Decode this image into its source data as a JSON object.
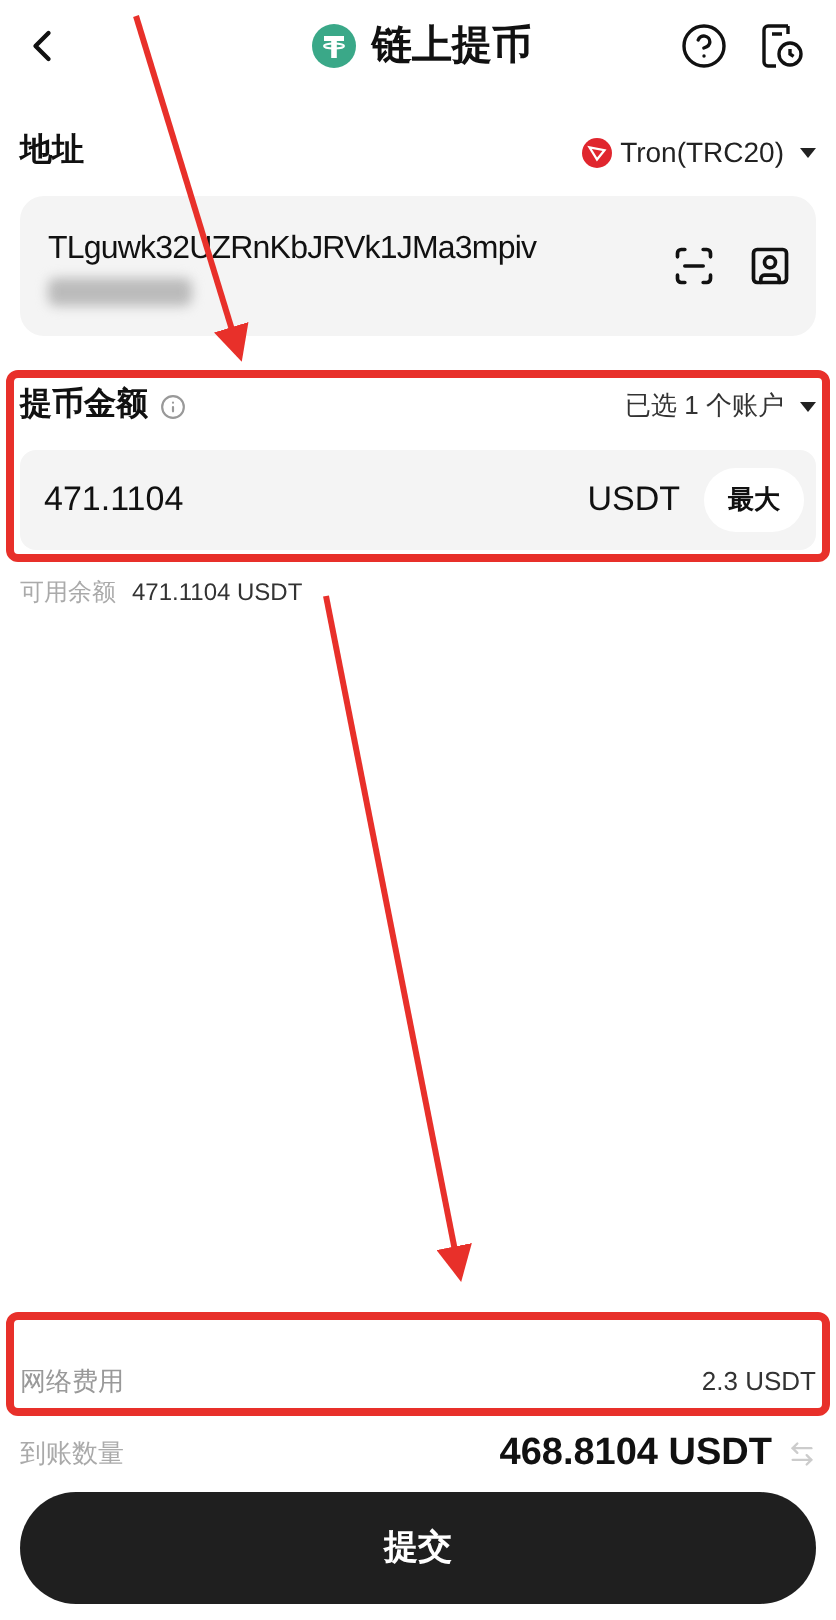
{
  "header": {
    "title": "链上提币"
  },
  "address": {
    "label": "地址",
    "network": "Tron(TRC20)",
    "value": "TLguwk32UZRnKbJRVk1JMa3mpiv",
    "redacted": true
  },
  "amount": {
    "label": "提币金额",
    "accounts": "已选 1 个账户",
    "value": "471.1104",
    "unit": "USDT",
    "max_button": "最大"
  },
  "available": {
    "label": "可用余额",
    "value": "471.1104 USDT"
  },
  "fee": {
    "label": "网络费用",
    "value": "2.3 USDT"
  },
  "received": {
    "label": "到账数量",
    "value": "468.8104 USDT"
  },
  "submit": "提交",
  "annotations": [
    {
      "kind": "arrow"
    },
    {
      "kind": "box"
    },
    {
      "kind": "arrow"
    },
    {
      "kind": "box"
    }
  ]
}
